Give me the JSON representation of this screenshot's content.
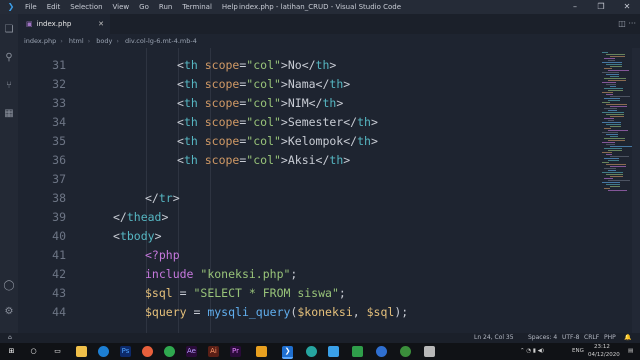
{
  "window": {
    "title": "index.php - latihan_CRUD - Visual Studio Code",
    "menu": [
      "File",
      "Edit",
      "Selection",
      "View",
      "Go",
      "Run",
      "Terminal",
      "Help"
    ]
  },
  "tab": {
    "icon": "php-icon",
    "label": "index.php"
  },
  "breadcrumb": [
    "index.php",
    "html",
    "body",
    "div.col-lg-6.mt-4.mb-4"
  ],
  "code_lines": [
    {
      "n": "31",
      "indent": 10,
      "tokens": [
        [
          "o",
          "<"
        ],
        [
          "t",
          "th"
        ],
        [
          "o",
          " "
        ],
        [
          "a",
          "scope"
        ],
        [
          "o",
          "="
        ],
        [
          "s",
          "\"col\""
        ],
        [
          "o",
          ">No</"
        ],
        [
          "t",
          "th"
        ],
        [
          "o",
          ">"
        ]
      ]
    },
    {
      "n": "32",
      "indent": 10,
      "tokens": [
        [
          "o",
          "<"
        ],
        [
          "t",
          "th"
        ],
        [
          "o",
          " "
        ],
        [
          "a",
          "scope"
        ],
        [
          "o",
          "="
        ],
        [
          "s",
          "\"col\""
        ],
        [
          "o",
          ">Nama</"
        ],
        [
          "t",
          "th"
        ],
        [
          "o",
          ">"
        ]
      ]
    },
    {
      "n": "33",
      "indent": 10,
      "tokens": [
        [
          "o",
          "<"
        ],
        [
          "t",
          "th"
        ],
        [
          "o",
          " "
        ],
        [
          "a",
          "scope"
        ],
        [
          "o",
          "="
        ],
        [
          "s",
          "\"col\""
        ],
        [
          "o",
          ">NIM</"
        ],
        [
          "t",
          "th"
        ],
        [
          "o",
          ">"
        ]
      ]
    },
    {
      "n": "34",
      "indent": 10,
      "tokens": [
        [
          "o",
          "<"
        ],
        [
          "t",
          "th"
        ],
        [
          "o",
          " "
        ],
        [
          "a",
          "scope"
        ],
        [
          "o",
          "="
        ],
        [
          "s",
          "\"col\""
        ],
        [
          "o",
          ">Semester</"
        ],
        [
          "t",
          "th"
        ],
        [
          "o",
          ">"
        ]
      ]
    },
    {
      "n": "35",
      "indent": 10,
      "tokens": [
        [
          "o",
          "<"
        ],
        [
          "t",
          "th"
        ],
        [
          "o",
          " "
        ],
        [
          "a",
          "scope"
        ],
        [
          "o",
          "="
        ],
        [
          "s",
          "\"col\""
        ],
        [
          "o",
          ">Kelompok</"
        ],
        [
          "t",
          "th"
        ],
        [
          "o",
          ">"
        ]
      ]
    },
    {
      "n": "36",
      "indent": 10,
      "tokens": [
        [
          "o",
          "<"
        ],
        [
          "t",
          "th"
        ],
        [
          "o",
          " "
        ],
        [
          "a",
          "scope"
        ],
        [
          "o",
          "="
        ],
        [
          "s",
          "\"col\""
        ],
        [
          "o",
          ">Aksi</"
        ],
        [
          "t",
          "th"
        ],
        [
          "o",
          ">"
        ]
      ]
    },
    {
      "n": "37",
      "indent": 0,
      "tokens": []
    },
    {
      "n": "38",
      "indent": 8,
      "tokens": [
        [
          "o",
          "</"
        ],
        [
          "t",
          "tr"
        ],
        [
          "o",
          ">"
        ]
      ]
    },
    {
      "n": "39",
      "indent": 6,
      "tokens": [
        [
          "o",
          "</"
        ],
        [
          "t",
          "thead"
        ],
        [
          "o",
          ">"
        ]
      ]
    },
    {
      "n": "40",
      "indent": 6,
      "tokens": [
        [
          "o",
          "<"
        ],
        [
          "t",
          "tbody"
        ],
        [
          "o",
          ">"
        ]
      ]
    },
    {
      "n": "41",
      "indent": 8,
      "tokens": [
        [
          "k",
          "<?php"
        ]
      ]
    },
    {
      "n": "42",
      "indent": 8,
      "tokens": [
        [
          "k",
          "include"
        ],
        [
          "o",
          " "
        ],
        [
          "s",
          "\"koneksi.php\""
        ],
        [
          "o",
          ";"
        ]
      ]
    },
    {
      "n": "43",
      "indent": 8,
      "tokens": [
        [
          "v",
          "$sql"
        ],
        [
          "o",
          " = "
        ],
        [
          "s",
          "\"SELECT * FROM siswa\""
        ],
        [
          "o",
          ";"
        ]
      ]
    },
    {
      "n": "44",
      "indent": 8,
      "tokens": [
        [
          "v",
          "$query"
        ],
        [
          "o",
          " = "
        ],
        [
          "f",
          "mysqli_query"
        ],
        [
          "o",
          "("
        ],
        [
          "v",
          "$koneksi"
        ],
        [
          "o",
          ", "
        ],
        [
          "v",
          "$sql"
        ],
        [
          "o",
          ");"
        ]
      ]
    }
  ],
  "status": {
    "position": "Ln 24, Col 35",
    "spaces": "Spaces: 4",
    "encoding": "UTF-8",
    "eol": "CRLF",
    "language": "PHP"
  },
  "taskbar": {
    "lang": "ENG",
    "time": "23:12",
    "date": "04/12/2020"
  },
  "colors": {
    "editor_bg": "#1e2430",
    "tag": "#56b6c2",
    "attribute": "#d19a66",
    "string": "#98c379",
    "keyword": "#c678dd",
    "variable": "#e5c07b",
    "function": "#61afef"
  }
}
